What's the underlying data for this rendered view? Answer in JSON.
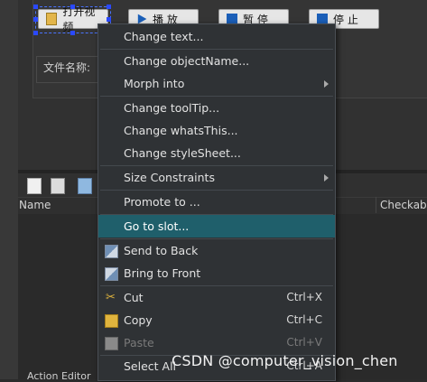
{
  "form": {
    "buttons": [
      {
        "label": "打开视频",
        "icon": "folder-icon"
      },
      {
        "label": "播 放",
        "icon": "play-icon"
      },
      {
        "label": "暂 停",
        "icon": "pause-icon"
      },
      {
        "label": "停 止",
        "icon": "stop-icon"
      }
    ],
    "file_label": "文件名称:"
  },
  "object_inspector": {
    "header_name": "Name",
    "header_checkable": "Checkable"
  },
  "bottom_tab": "Action Editor",
  "context_menu": {
    "items": [
      {
        "label": "Change text...",
        "shortcut": "",
        "submenu": false
      },
      {
        "label": "Change objectName...",
        "shortcut": "",
        "submenu": false
      },
      {
        "label": "Morph into",
        "shortcut": "",
        "submenu": true
      },
      {
        "label": "Change toolTip...",
        "shortcut": "",
        "submenu": false
      },
      {
        "label": "Change whatsThis...",
        "shortcut": "",
        "submenu": false
      },
      {
        "label": "Change styleSheet...",
        "shortcut": "",
        "submenu": false
      },
      {
        "label": "Size Constraints",
        "shortcut": "",
        "submenu": true
      },
      {
        "label": "Promote to ...",
        "shortcut": "",
        "submenu": false
      },
      {
        "label": "Go to slot...",
        "shortcut": "",
        "submenu": false,
        "highlighted": true
      },
      {
        "label": "Send to Back",
        "shortcut": "",
        "submenu": false,
        "icon": "send-to-back-icon"
      },
      {
        "label": "Bring to Front",
        "shortcut": "",
        "submenu": false,
        "icon": "bring-to-front-icon"
      },
      {
        "label": "Cut",
        "shortcut": "Ctrl+X",
        "submenu": false,
        "icon": "scissors-icon"
      },
      {
        "label": "Copy",
        "shortcut": "Ctrl+C",
        "submenu": false,
        "icon": "copy-icon"
      },
      {
        "label": "Paste",
        "shortcut": "Ctrl+V",
        "submenu": false,
        "icon": "paste-icon",
        "disabled": true
      },
      {
        "label": "Select All",
        "shortcut": "Ctrl+A",
        "submenu": false
      }
    ]
  },
  "watermark": "CSDN @computer_vision_chen",
  "colors": {
    "menu_highlight": "#1f5f6b",
    "selection_handle": "#2a49ff"
  }
}
